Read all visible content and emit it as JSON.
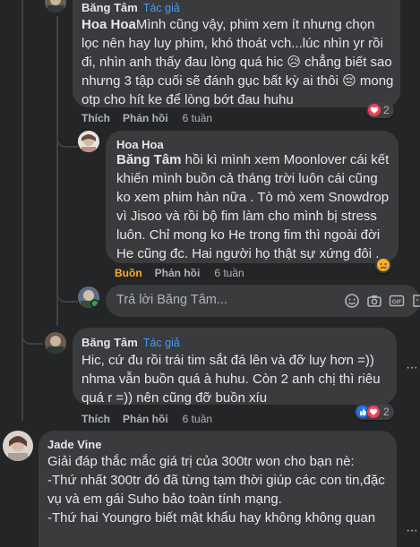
{
  "comments": [
    {
      "author": "Băng Tâm",
      "tag": "Tác giả"
    },
    {
      "author_inline": "Hoa Hoa",
      "text": "Mình cũng vậy, phim xem ít nhưng chọn lọc nên hay luy phim, khó thoát vch...lúc nhìn yr rồi đi, nhìn anh thấy đau lòng quá hic 😥 chẳng biết sao nhưng 3 tập cuối sẽ đánh gục bất kỳ ai thôi 😔 mong otp cho hít ke để lòng bớt đau huhu",
      "like_label": "Thích",
      "reply_label": "Phản hồi",
      "time": "6 tuần",
      "reaction_count": "2"
    },
    {
      "author": "Hoa Hoa",
      "mention": "Băng Tâm",
      "text": " hồi kì mình xem Moonlover cái kết khiến mình buồn cả tháng trời luôn cái cũng ko xem phim hàn nữa . Tò mò xem Snowdrop vì Jisoo và rồi bộ fim làm cho mình bị stress luôn. Chỉ mong ko He trong fim thì ngoài đời He cũng đc. Hai người họ thật sự xứng đôi .",
      "like_label": "Buồn",
      "reply_label": "Phản hồi",
      "time": "6 tuần"
    },
    {
      "reply_placeholder": "Trả lời Băng Tâm..."
    },
    {
      "author": "Băng Tâm",
      "tag": "Tác giả",
      "text": "Hic, cứ đu rồi trái tim sắt đá lên và đỡ luy hơn =)) nhma vẫn buồn quá à huhu. Còn 2 anh chị thì riêu quá r =)) nên cũng đỡ buồn xíu",
      "like_label": "Thích",
      "reply_label": "Phản hồi",
      "time": "6 tuần",
      "reaction_count": "2"
    },
    {
      "author": "Jade Vine",
      "text": "Giải đáp thắc mắc giá trị của 300tr won cho bạn nè:\n-Thứ nhất 300tr đó đã từng tạm thời giúp các con tin,đặc vụ và em gái Suho bảo toàn tính mạng.\n-Thứ hai Youngro biết mật khẩu hay không không quan"
    }
  ],
  "colors": {
    "background": "#242526",
    "bubble": "#3a3b3c",
    "accent": "#4599ff",
    "sad_reaction": "#f7b125",
    "like": "#1877f2",
    "heart": "#f33e58"
  },
  "icons": [
    "emoji-icon",
    "camera-icon",
    "gif-icon",
    "sticker-icon",
    "more-options-icon"
  ]
}
